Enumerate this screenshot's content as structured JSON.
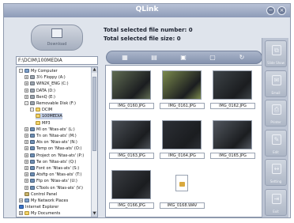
{
  "window": {
    "title": "QLink"
  },
  "download_button": {
    "label": "Download"
  },
  "info": {
    "selected_file_number": "Total selected file number: 0",
    "selected_file_size": "Total selected file size: 0"
  },
  "path": "F:\\DCIM\\100MEDIA",
  "tree": [
    {
      "label": "My Computer",
      "icon": "computer-icon",
      "expander": "-"
    },
    {
      "label": "3½ Floppy (A:)",
      "icon": "floppy-icon",
      "expander": "+"
    },
    {
      "label": "WIN2K_ENG (C:)",
      "icon": "drive-icon",
      "expander": "+"
    },
    {
      "label": "DATA (D:)",
      "icon": "drive-icon",
      "expander": "+"
    },
    {
      "label": "BenQ (E:)",
      "icon": "drive-icon",
      "expander": "+"
    },
    {
      "label": "Removable Disk (F:)",
      "icon": "drive-icon",
      "expander": "-"
    },
    {
      "label": "DCIM",
      "icon": "folder-icon",
      "expander": "-"
    },
    {
      "label": "100MEDIA",
      "icon": "folder-icon",
      "expander": ""
    },
    {
      "label": "MP3",
      "icon": "folder-icon",
      "expander": ""
    },
    {
      "label": "MI on 'Ntas-ats' (L:)",
      "icon": "network-drive-icon",
      "expander": "+"
    },
    {
      "label": "Tn on 'Ntas-ats' (M:)",
      "icon": "network-drive-icon",
      "expander": "+"
    },
    {
      "label": "Ats on 'Ntas-ats' (N:)",
      "icon": "network-drive-icon",
      "expander": "+"
    },
    {
      "label": "Temp on 'Ntas-ats' (O:)",
      "icon": "network-drive-icon",
      "expander": "+"
    },
    {
      "label": "Project on 'Ntas-ats' (P:)",
      "icon": "network-drive-icon",
      "expander": "+"
    },
    {
      "label": "Tw on 'Ntas-ats' (Q:)",
      "icon": "network-drive-icon",
      "expander": "+"
    },
    {
      "label": "Font on 'Ntas-ats' (S:)",
      "icon": "network-drive-icon",
      "expander": "+"
    },
    {
      "label": "Atsftp on 'Ntas-ats' (T:)",
      "icon": "network-drive-icon",
      "expander": "+"
    },
    {
      "label": "Ftp on 'Ntas-ats' (U:)",
      "icon": "network-drive-icon",
      "expander": "+"
    },
    {
      "label": "CTools on 'Ntas-ats' (V:)",
      "icon": "network-drive-icon",
      "expander": "+"
    },
    {
      "label": "Control Panel",
      "icon": "control-panel-icon",
      "expander": ""
    },
    {
      "label": "My Network Places",
      "icon": "network-places-icon",
      "expander": "+"
    },
    {
      "label": "Internet Explorer",
      "icon": "internet-explorer-icon",
      "expander": ""
    },
    {
      "label": "My Documents",
      "icon": "documents-icon",
      "expander": "+"
    }
  ],
  "toolbar": [
    {
      "icon": "thumbnail-view-icon",
      "glyph": "▦"
    },
    {
      "icon": "list-view-icon",
      "glyph": "▤"
    },
    {
      "icon": "select-all-icon",
      "glyph": "▣"
    },
    {
      "icon": "deselect-icon",
      "glyph": "▢"
    },
    {
      "icon": "refresh-icon",
      "glyph": "↻"
    }
  ],
  "files": [
    {
      "name": "IMG_0160.JPG",
      "type": "photo",
      "tone": "#5f6b52"
    },
    {
      "name": "IMG_0161.JPG",
      "type": "photo",
      "tone": "#7b8a4c"
    },
    {
      "name": "IMG_0162.JPG",
      "type": "photo",
      "tone": "#3d4347"
    },
    {
      "name": "IMG_0163.JPG",
      "type": "photo",
      "tone": "#4a4f55"
    },
    {
      "name": "IMG_0164.JPG",
      "type": "photo",
      "tone": "#2c2f35"
    },
    {
      "name": "IMG_0165.JPG",
      "type": "photo",
      "tone": "#51565e"
    },
    {
      "name": "IMG_0166.JPG",
      "type": "photo",
      "tone": "#3a3d42"
    },
    {
      "name": "IMG_0168.WAV",
      "type": "audio",
      "tone": "#ffffff"
    }
  ],
  "side_buttons": [
    {
      "label": "Slide Show",
      "icon": "slideshow-icon",
      "glyph": "⧉"
    },
    {
      "label": "Email",
      "icon": "email-icon",
      "glyph": "✉"
    },
    {
      "label": "Printer",
      "icon": "printer-icon",
      "glyph": "⎙"
    },
    {
      "label": "Edit",
      "icon": "edit-icon",
      "glyph": "✎"
    },
    {
      "label": "Setting",
      "icon": "setting-icon",
      "glyph": "↔"
    },
    {
      "label": "Exit",
      "icon": "exit-icon",
      "glyph": "⇥"
    }
  ],
  "colors": {
    "title_bar": "#8d9bb8",
    "panel": "#dfe4ec",
    "side_panel": "#bcc4d3"
  }
}
